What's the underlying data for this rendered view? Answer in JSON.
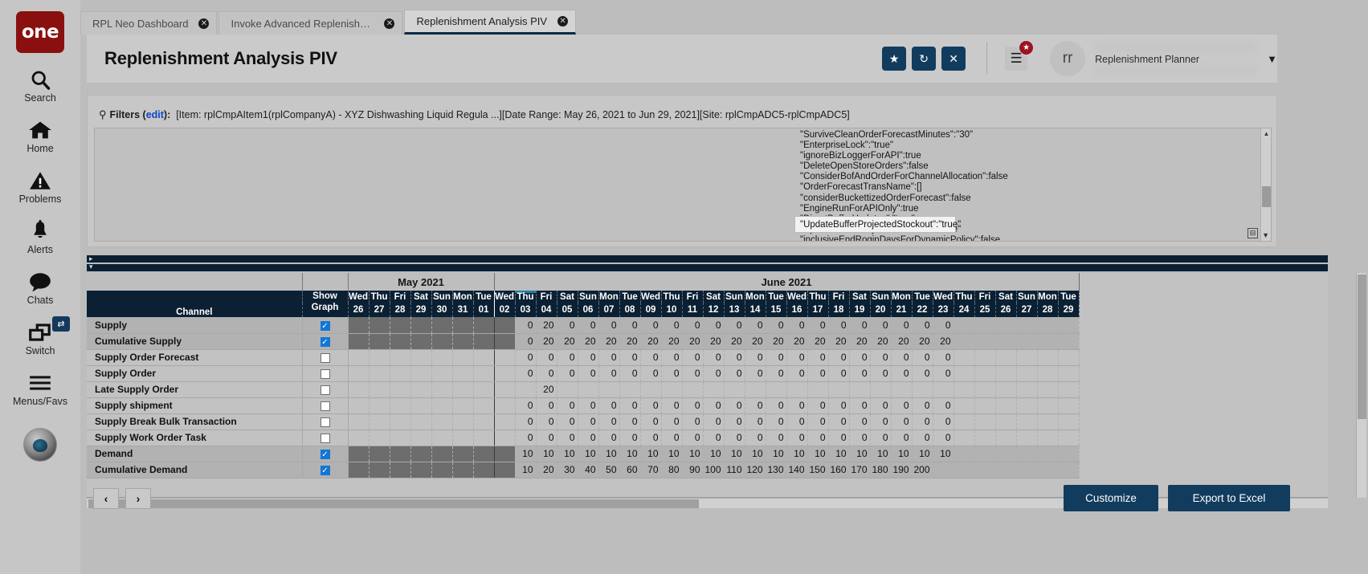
{
  "sidebar": {
    "logo_text": "one",
    "items": [
      {
        "label": "Search",
        "icon": "search-icon"
      },
      {
        "label": "Home",
        "icon": "home-icon"
      },
      {
        "label": "Problems",
        "icon": "warning-triangle-icon"
      },
      {
        "label": "Alerts",
        "icon": "bell-icon"
      },
      {
        "label": "Chats",
        "icon": "chat-bubble-icon"
      },
      {
        "label": "Switch",
        "icon": "windows-stack-icon",
        "badge": "⇄"
      },
      {
        "label": "Menus/Favs",
        "icon": "hamburger-icon"
      }
    ]
  },
  "tabs": [
    {
      "label": "RPL Neo Dashboard",
      "active": false,
      "close": "✕"
    },
    {
      "label": "Invoke Advanced Replenishment...",
      "active": false,
      "close": "✕"
    },
    {
      "label": "Replenishment Analysis PIV",
      "active": true,
      "close": "✕"
    }
  ],
  "header": {
    "title": "Replenishment Analysis PIV",
    "actions": [
      {
        "name": "favorite",
        "glyph": "★"
      },
      {
        "name": "refresh",
        "glyph": "↻"
      },
      {
        "name": "close",
        "glyph": "✕"
      }
    ],
    "menu_glyph": "☰",
    "menu_badge_glyph": "★",
    "avatar_initials": "rr",
    "user_role": "Replenishment Planner",
    "caret": "▼"
  },
  "filters": {
    "icon_glyph": "⚲",
    "label": "Filters (",
    "edit_link": "edit",
    "label_end": "):",
    "summary": "[Item: rplCmpAItem1(rplCompanyA) - XYZ Dishwashing Liquid Regula ...][Date Range: May 26, 2021 to Jun 29, 2021][Site: rplCmpADC5-rplCmpADC5]"
  },
  "json_config": {
    "lines": [
      "\"SurviveCleanOrderForecastMinutes\":\"30\"",
      "\"EnterpriseLock\":\"true\"",
      "\"ignoreBizLoggerForAPI\":true",
      "\"DeleteOpenStoreOrders\":false",
      "\"ConsiderBofAndOrderForChannelAllocation\":false",
      "\"OrderForecastTransName\":[]",
      "\"considerBuckettizedOrderForecast\":false",
      "\"EngineRunForAPIOnly\":true",
      "\"DirectBufferUpdates\":\"true\"",
      "\"UpdateBufferProjectedStockout\":\"true\"",
      "\"inclusiveEndRoqinDaysForDynamicPolicy\":false"
    ],
    "tooltip_text": "\"UpdateBufferProjectedStockout\":\"true\"",
    "restore_glyph": "⊟",
    "caret_glyph": "▼",
    "scroll_up_glyph": "▲",
    "scroll_down_glyph": "▼"
  },
  "grid": {
    "col_channel_header": "Channel",
    "col_show_header_l1": "Show",
    "col_show_header_l2": "Graph",
    "months": [
      {
        "label": "May 2021",
        "span": 7
      },
      {
        "label": "June 2021",
        "span": 29
      }
    ],
    "days": [
      "Wed",
      "Thu",
      "Fri",
      "Sat",
      "Sun",
      "Mon",
      "Tue",
      "Wed",
      "Thu",
      "Fri",
      "Sat",
      "Sun",
      "Mon",
      "Tue",
      "Wed",
      "Thu",
      "Fri",
      "Sat",
      "Sun",
      "Mon",
      "Tue",
      "Wed",
      "Thu",
      "Fri",
      "Sat",
      "Sun",
      "Mon",
      "Tue",
      "Wed",
      "Thu",
      "Fri",
      "Sat",
      "Sun",
      "Mon",
      "Tue"
    ],
    "dates": [
      "26",
      "27",
      "28",
      "29",
      "30",
      "31",
      "01",
      "02",
      "03",
      "04",
      "05",
      "06",
      "07",
      "08",
      "09",
      "10",
      "11",
      "12",
      "13",
      "14",
      "15",
      "16",
      "17",
      "18",
      "19",
      "20",
      "21",
      "22",
      "23",
      "24",
      "25",
      "26",
      "27",
      "28",
      "29"
    ],
    "today_index": 8,
    "month_break_index": 7,
    "rows": [
      {
        "label": "Supply",
        "checked": true,
        "highlight": true,
        "shaded_until": 8,
        "values": [
          "",
          "",
          "",
          "",
          "",
          "",
          "",
          "",
          "0",
          "20",
          "0",
          "0",
          "0",
          "0",
          "0",
          "0",
          "0",
          "0",
          "0",
          "0",
          "0",
          "0",
          "0",
          "0",
          "0",
          "0",
          "0",
          "0",
          "0",
          "",
          "",
          "",
          "",
          "",
          ""
        ]
      },
      {
        "label": "Cumulative Supply",
        "checked": true,
        "highlight": true,
        "shaded_until": 8,
        "values": [
          "",
          "",
          "",
          "",
          "",
          "",
          "",
          "",
          "0",
          "20",
          "20",
          "20",
          "20",
          "20",
          "20",
          "20",
          "20",
          "20",
          "20",
          "20",
          "20",
          "20",
          "20",
          "20",
          "20",
          "20",
          "20",
          "20",
          "20",
          "",
          "",
          "",
          "",
          "",
          ""
        ]
      },
      {
        "label": "Supply Order Forecast",
        "checked": false,
        "highlight": false,
        "shaded_until": 0,
        "values": [
          "",
          "",
          "",
          "",
          "",
          "",
          "",
          "",
          "0",
          "0",
          "0",
          "0",
          "0",
          "0",
          "0",
          "0",
          "0",
          "0",
          "0",
          "0",
          "0",
          "0",
          "0",
          "0",
          "0",
          "0",
          "0",
          "0",
          "0",
          "",
          "",
          "",
          "",
          "",
          ""
        ]
      },
      {
        "label": "Supply Order",
        "checked": false,
        "highlight": false,
        "shaded_until": 0,
        "values": [
          "",
          "",
          "",
          "",
          "",
          "",
          "",
          "",
          "0",
          "0",
          "0",
          "0",
          "0",
          "0",
          "0",
          "0",
          "0",
          "0",
          "0",
          "0",
          "0",
          "0",
          "0",
          "0",
          "0",
          "0",
          "0",
          "0",
          "0",
          "",
          "",
          "",
          "",
          "",
          ""
        ]
      },
      {
        "label": "Late Supply Order",
        "checked": false,
        "highlight": false,
        "shaded_until": 0,
        "values": [
          "",
          "",
          "",
          "",
          "",
          "",
          "",
          "",
          "",
          "20",
          "",
          "",
          "",
          "",
          "",
          "",
          "",
          "",
          "",
          "",
          "",
          "",
          "",
          "",
          "",
          "",
          "",
          "",
          "",
          "",
          "",
          "",
          "",
          "",
          ""
        ]
      },
      {
        "label": "Supply shipment",
        "checked": false,
        "highlight": false,
        "shaded_until": 0,
        "values": [
          "",
          "",
          "",
          "",
          "",
          "",
          "",
          "",
          "0",
          "0",
          "0",
          "0",
          "0",
          "0",
          "0",
          "0",
          "0",
          "0",
          "0",
          "0",
          "0",
          "0",
          "0",
          "0",
          "0",
          "0",
          "0",
          "0",
          "0",
          "",
          "",
          "",
          "",
          "",
          ""
        ]
      },
      {
        "label": "Supply Break Bulk Transaction",
        "checked": false,
        "highlight": false,
        "shaded_until": 0,
        "values": [
          "",
          "",
          "",
          "",
          "",
          "",
          "",
          "",
          "0",
          "0",
          "0",
          "0",
          "0",
          "0",
          "0",
          "0",
          "0",
          "0",
          "0",
          "0",
          "0",
          "0",
          "0",
          "0",
          "0",
          "0",
          "0",
          "0",
          "0",
          "",
          "",
          "",
          "",
          "",
          ""
        ]
      },
      {
        "label": "Supply Work Order Task",
        "checked": false,
        "highlight": false,
        "shaded_until": 0,
        "values": [
          "",
          "",
          "",
          "",
          "",
          "",
          "",
          "",
          "0",
          "0",
          "0",
          "0",
          "0",
          "0",
          "0",
          "0",
          "0",
          "0",
          "0",
          "0",
          "0",
          "0",
          "0",
          "0",
          "0",
          "0",
          "0",
          "0",
          "0",
          "",
          "",
          "",
          "",
          "",
          ""
        ]
      },
      {
        "label": "Demand",
        "checked": true,
        "highlight": true,
        "shaded_until": 8,
        "values": [
          "",
          "",
          "",
          "",
          "",
          "",
          "",
          "",
          "10",
          "10",
          "10",
          "10",
          "10",
          "10",
          "10",
          "10",
          "10",
          "10",
          "10",
          "10",
          "10",
          "10",
          "10",
          "10",
          "10",
          "10",
          "10",
          "10",
          "10",
          "",
          "",
          "",
          "",
          "",
          ""
        ]
      },
      {
        "label": "Cumulative Demand",
        "checked": true,
        "highlight": true,
        "shaded_until": 8,
        "values": [
          "",
          "",
          "",
          "",
          "",
          "",
          "",
          "",
          "10",
          "20",
          "30",
          "40",
          "50",
          "60",
          "70",
          "80",
          "90",
          "100",
          "110",
          "120",
          "130",
          "140",
          "150",
          "160",
          "170",
          "180",
          "190",
          "200",
          "",
          "",
          "",
          "",
          "",
          "",
          ""
        ]
      }
    ]
  },
  "footer": {
    "prev_glyph": "‹",
    "next_glyph": "›",
    "customize_label": "Customize",
    "export_label": "Export to Excel"
  },
  "colors": {
    "accent_dark": "#123c5e",
    "grid_header": "#0b2033",
    "today_marker": "#1b7f9e",
    "checkbox_on": "#1277d4",
    "logo_red": "#8a1010",
    "badge_red": "#9c1420",
    "link_blue": "#0b46c9"
  }
}
